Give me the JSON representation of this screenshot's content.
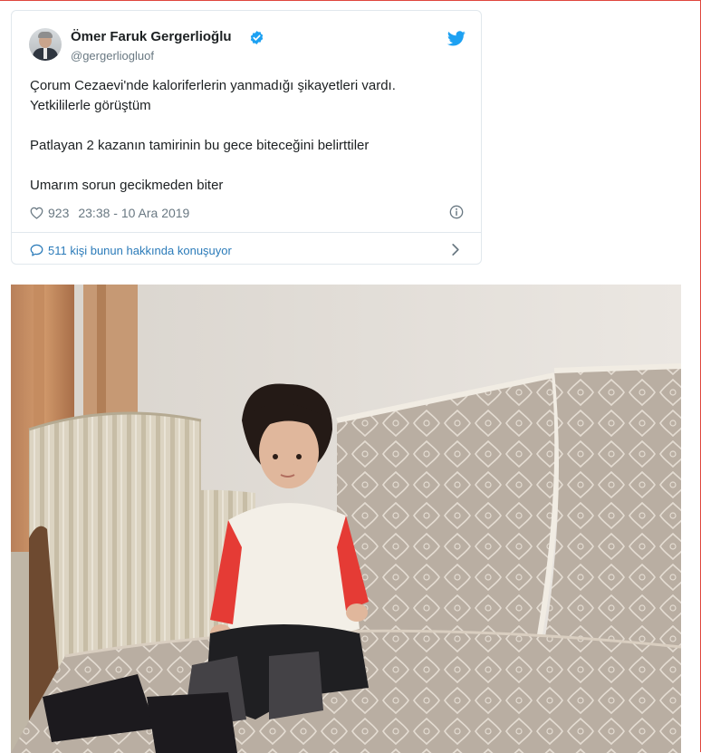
{
  "tweet": {
    "author_name": "Ömer Faruk Gergerlioğlu",
    "handle": "@gergerliogluof",
    "verified": true,
    "text_lines": [
      "Çorum Cezaevi'nde kaloriferlerin yanmadığı şikayetleri vardı.",
      "Yetkililerle görüştüm",
      "Patlayan 2 kazanın tamirinin bu gece biteceğini belirttiler",
      "Umarım sorun gecikmeden biter"
    ],
    "like_count": "923",
    "timestamp": "23:38 - 10 Ara 2019",
    "conversation_text": "511 kişi bunun hakkında konuşuyor"
  },
  "icons": {
    "verified": "verified-badge-icon",
    "logo": "twitter-bird-icon",
    "like": "heart-icon",
    "info": "info-icon",
    "reply": "speech-bubble-icon",
    "more": "chevron-right-icon"
  },
  "colors": {
    "link": "#2b7bb9",
    "twitter_blue": "#1da1f2",
    "muted_text": "#697882",
    "border": "#e1e8ed",
    "page_frame": "#e0473e"
  }
}
